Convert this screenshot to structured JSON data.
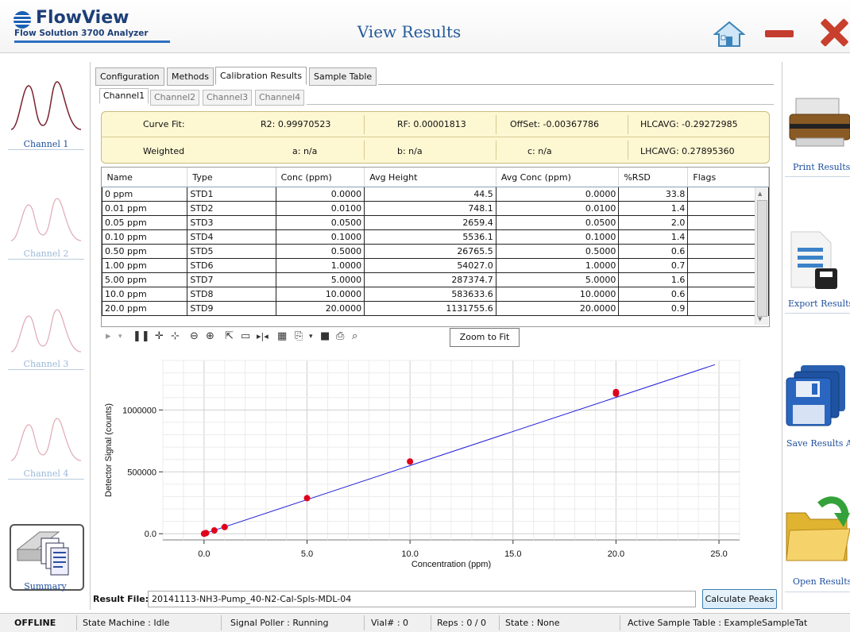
{
  "header": {
    "logo_title": "FlowView",
    "logo_subtitle": "Flow Solution 3700 Analyzer",
    "page_title": "View Results"
  },
  "left_rail": {
    "channels": [
      {
        "label": "Channel 1",
        "color": "#7a2230",
        "active": true
      },
      {
        "label": "Channel 2",
        "color": "#e8b4be",
        "active": false
      },
      {
        "label": "Channel 3",
        "color": "#e8b4be",
        "active": false
      },
      {
        "label": "Channel 4",
        "color": "#e8b4be",
        "active": false
      }
    ],
    "summary_label": "Summary"
  },
  "tabs": [
    "Configuration",
    "Methods",
    "Calibration Results",
    "Sample Table"
  ],
  "active_tab": "Calibration Results",
  "subtabs": [
    "Channel1",
    "Channel2",
    "Channel3",
    "Channel4"
  ],
  "active_subtab": "Channel1",
  "curve_fit": {
    "label": "Curve Fit:",
    "r2": "R2: 0.99970523",
    "rf": "RF: 0.00001813",
    "offset": "OffSet: -0.00367786",
    "hlcavg": "HLCAVG: -0.29272985",
    "weighted": "Weighted",
    "a": "a: n/a",
    "b": "b: n/a",
    "c": "c: n/a",
    "lhcavg": "LHCAVG: 0.27895360"
  },
  "table": {
    "columns": [
      "Name",
      "Type",
      "Conc (ppm)",
      "Avg Height",
      "Avg Conc (ppm)",
      "%RSD",
      "Flags"
    ],
    "rows": [
      [
        "0 ppm",
        "STD1",
        "0.0000",
        "44.5",
        "0.0000",
        "33.8",
        ""
      ],
      [
        "0.01 ppm",
        "STD2",
        "0.0100",
        "748.1",
        "0.0100",
        "1.4",
        ""
      ],
      [
        "0.05 ppm",
        "STD3",
        "0.0500",
        "2659.4",
        "0.0500",
        "2.0",
        ""
      ],
      [
        "0.10 ppm",
        "STD4",
        "0.1000",
        "5536.1",
        "0.1000",
        "1.4",
        ""
      ],
      [
        "0.50 ppm",
        "STD5",
        "0.5000",
        "26765.5",
        "0.5000",
        "0.6",
        ""
      ],
      [
        "1.00 ppm",
        "STD6",
        "1.0000",
        "54027.0",
        "1.0000",
        "0.7",
        ""
      ],
      [
        "5.00 ppm",
        "STD7",
        "5.0000",
        "287374.7",
        "5.0000",
        "1.6",
        ""
      ],
      [
        "10.0 ppm",
        "STD8",
        "10.0000",
        "583633.6",
        "10.0000",
        "0.6",
        ""
      ],
      [
        "20.0 ppm",
        "STD9",
        "20.0000",
        "1131755.6",
        "20.0000",
        "0.9",
        ""
      ]
    ]
  },
  "toolbar": {
    "zoom_to_fit": "Zoom to Fit"
  },
  "chart_data": {
    "type": "scatter",
    "xlabel": "Concentration (ppm)",
    "ylabel": "Detector Signal (counts)",
    "xlim": [
      -2,
      26
    ],
    "ylim": [
      -50000,
      1400000
    ],
    "xticks": [
      0,
      5,
      10,
      15,
      20,
      25
    ],
    "xtick_labels": [
      "0.0",
      "5.0",
      "10.0",
      "15.0",
      "20.0",
      "25.0"
    ],
    "yticks": [
      0,
      500000,
      1000000
    ],
    "ytick_labels": [
      "0.0",
      "500000",
      "1000000"
    ],
    "grid": true,
    "series": [
      {
        "kind": "points",
        "color": "#e0001b",
        "x": [
          0,
          0.01,
          0.05,
          0.1,
          0.5,
          1.0,
          5.0,
          10.0,
          20.0,
          20.0
        ],
        "y": [
          44.5,
          748.1,
          2659.4,
          5536.1,
          26765.5,
          54027.0,
          287374.7,
          583633.6,
          1131755.6,
          1145000
        ]
      },
      {
        "kind": "line",
        "color": "#1f1fd6",
        "x": [
          0,
          24.8
        ],
        "y": [
          0,
          1366000
        ]
      }
    ]
  },
  "result": {
    "label": "Result File:",
    "value": "20141113-NH3-Pump_40-N2-Cal-Spls-MDL-04",
    "calc_button": "Calculate Peaks"
  },
  "right_rail": {
    "print": "Print Results",
    "export": "Export Results",
    "save": "Save Results A",
    "open": "Open Results"
  },
  "status": {
    "mode": "OFFLINE",
    "state_machine": "State Machine :  Idle",
    "signal_poller": "Signal Poller :  Running",
    "vial": "Vial# :  0",
    "reps": "Reps :  0 / 0",
    "state": "State :  None",
    "active_table": "Active Sample Table :  ExampleSampleTat"
  },
  "colors": {
    "brand": "#1d3f78",
    "accent": "#245a9c",
    "close": "#c8402d",
    "panel": "#fdf7d2"
  }
}
